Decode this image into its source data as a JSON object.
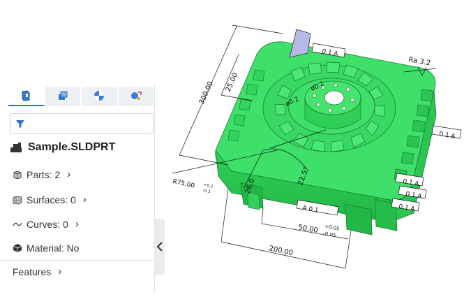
{
  "panel": {
    "tabs": [
      {
        "name": "model-tree-icon"
      },
      {
        "name": "assembly-icon"
      },
      {
        "name": "view-icon"
      },
      {
        "name": "measure-icon"
      }
    ],
    "file_name": "Sample.SLDPRT",
    "items": [
      {
        "label": "Parts: 2"
      },
      {
        "label": "Surfaces: 0"
      },
      {
        "label": "Curves: 0"
      },
      {
        "label": "Material: No"
      }
    ],
    "features_label": "Features"
  },
  "model": {
    "color": "#3ee06a",
    "annotations": {
      "d300": "300.00",
      "d25": "25.00",
      "d200": "200.00",
      "d50": "50.00",
      "d50_tol_upper": "+0.05",
      "d50_tol_lower": "-0.05",
      "r75": "R75.00",
      "r75_tol_upper": "+0.1",
      "r75_tol_lower": "-0.1",
      "d26": "26.0",
      "ang22": "22.5°",
      "ra": "Ra 3.2",
      "fcf_top": "0.1 A",
      "fcf_right1": "0.1 A",
      "fcf_right2": "0.1 A",
      "fcf_right3": "0.1 A",
      "fcf_right4": "0.1 A",
      "fcf_bottom": "A  0.1",
      "phi1": "ø0.2",
      "phi2": "ø0.2"
    }
  }
}
